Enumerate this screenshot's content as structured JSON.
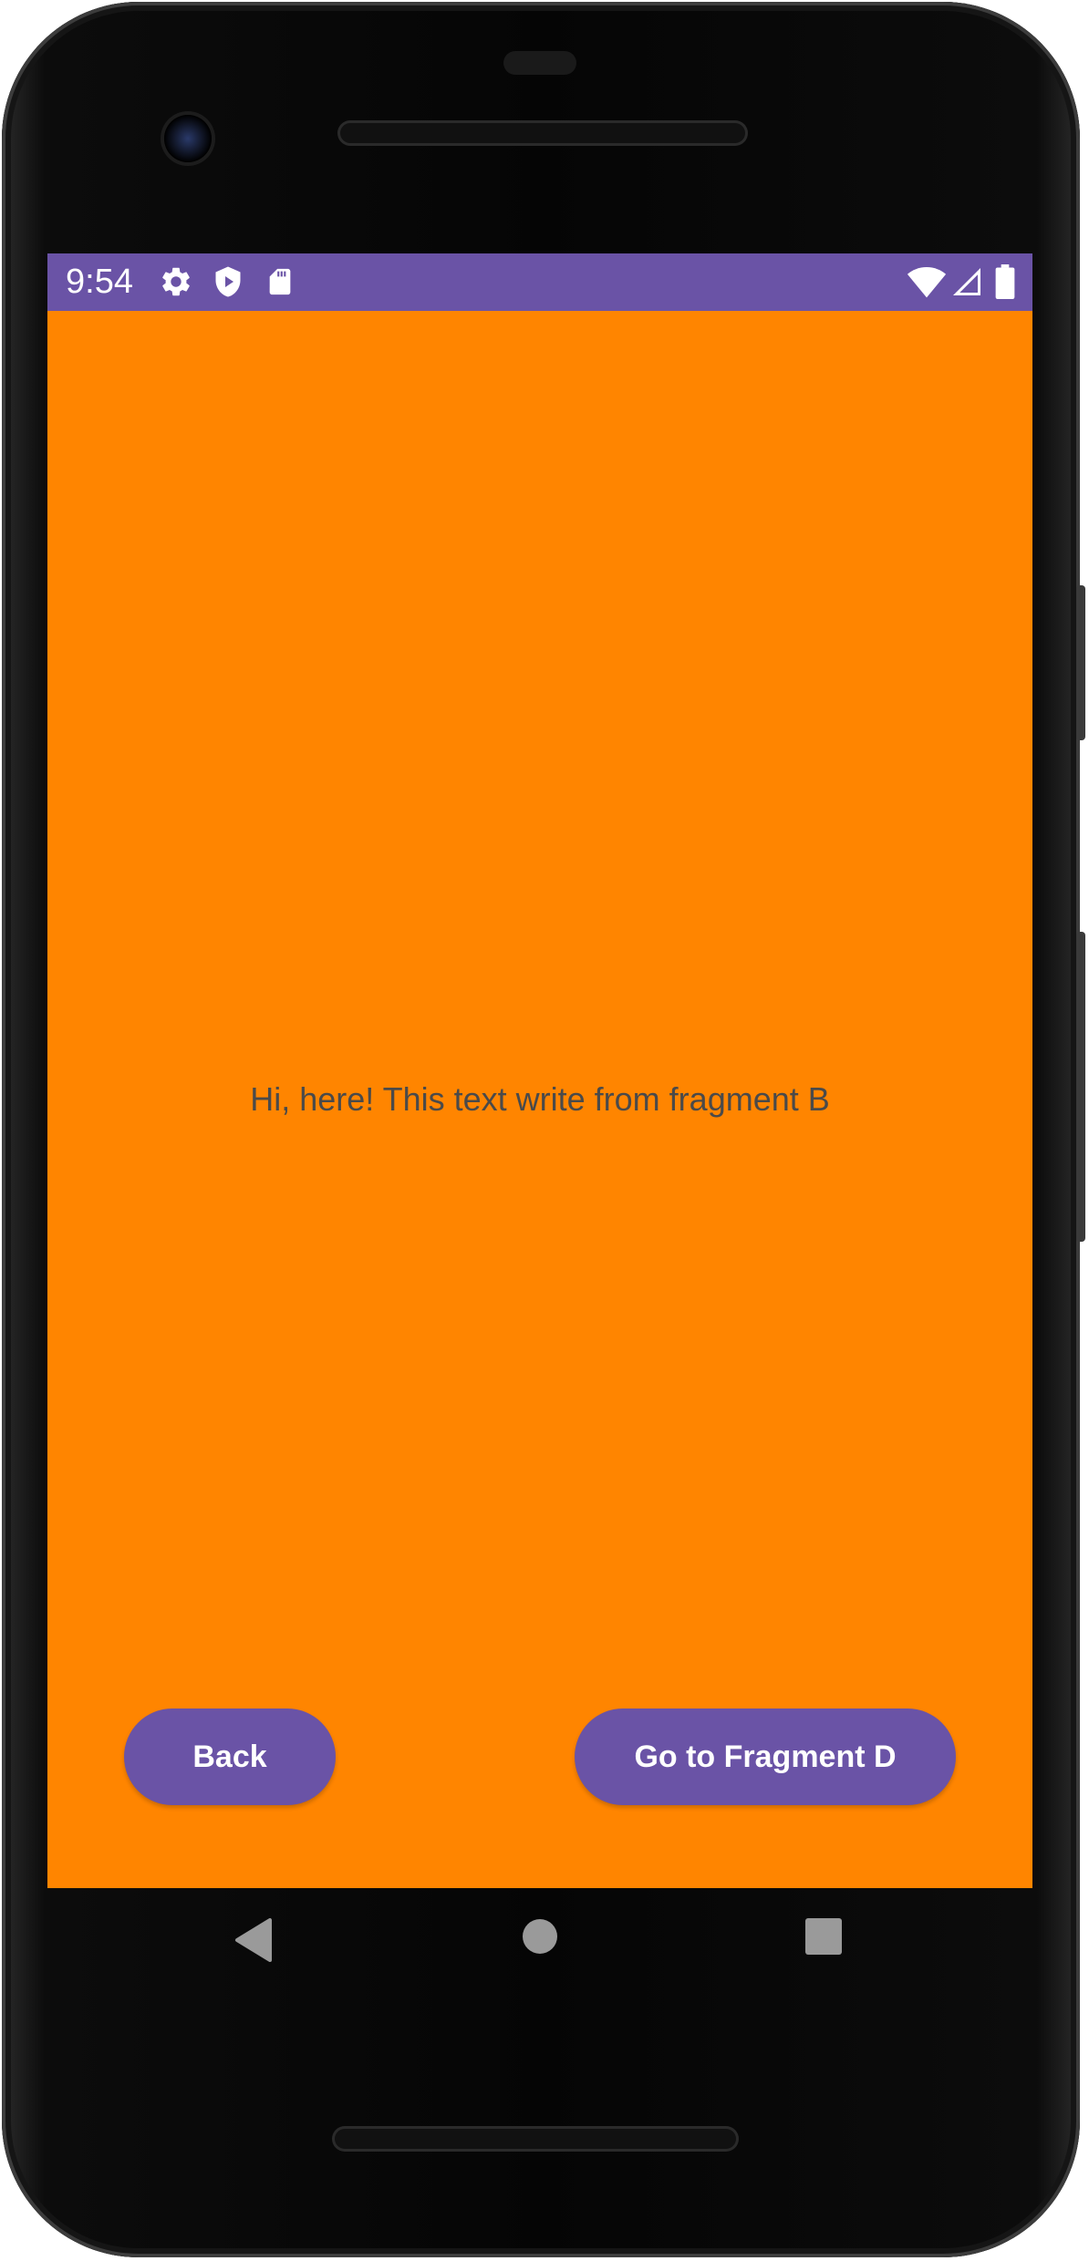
{
  "status_bar": {
    "time": "9:54",
    "left_icons": [
      "gear-icon",
      "shield-play-icon",
      "sd-card-icon"
    ],
    "right_icons": [
      "wifi-icon",
      "cell-signal-icon",
      "battery-icon"
    ],
    "background_color": "#6A53A6"
  },
  "screen": {
    "background_color": "#FF8500",
    "message": "Hi, here! This text write from fragment B"
  },
  "buttons": {
    "back_label": "Back",
    "next_label": "Go to Fragment D",
    "color": "#6A53A6"
  },
  "nav_bar": {
    "icons": [
      "back-triangle-icon",
      "home-circle-icon",
      "recents-square-icon"
    ]
  }
}
